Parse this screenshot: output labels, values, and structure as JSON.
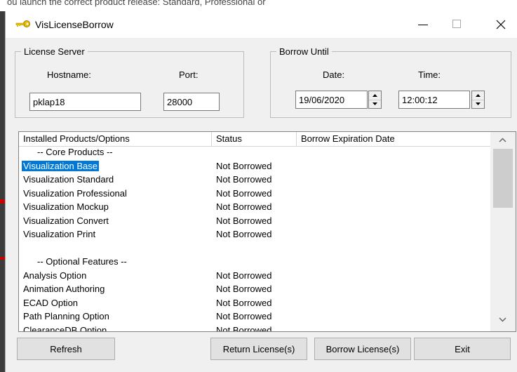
{
  "background": {
    "fragment_text": "ou launch the correct product release: Standard, Professional or"
  },
  "window": {
    "title": "VisLicenseBorrow"
  },
  "license_server": {
    "legend": "License Server",
    "hostname_label": "Hostname:",
    "hostname_value": "pklap18",
    "port_label": "Port:",
    "port_value": "28000"
  },
  "borrow_until": {
    "legend": "Borrow Until",
    "date_label": "Date:",
    "date_value": "19/06/2020",
    "time_label": "Time:",
    "time_value": "12:00:12"
  },
  "list": {
    "columns": [
      "Installed Products/Options",
      "Status",
      "Borrow Expiration Date"
    ],
    "rows": [
      {
        "name": "-- Core Products --",
        "status": "",
        "expiration": "",
        "kind": "header"
      },
      {
        "name": "Visualization Base",
        "status": "Not Borrowed",
        "expiration": "",
        "kind": "selected"
      },
      {
        "name": "Visualization Standard",
        "status": "Not Borrowed",
        "expiration": "",
        "kind": "item"
      },
      {
        "name": "Visualization Professional",
        "status": "Not Borrowed",
        "expiration": "",
        "kind": "item"
      },
      {
        "name": "Visualization Mockup",
        "status": "Not Borrowed",
        "expiration": "",
        "kind": "item"
      },
      {
        "name": "Visualization Convert",
        "status": "Not Borrowed",
        "expiration": "",
        "kind": "item"
      },
      {
        "name": "Visualization Print",
        "status": "Not Borrowed",
        "expiration": "",
        "kind": "item"
      },
      {
        "name": "",
        "status": "",
        "expiration": "",
        "kind": "blank"
      },
      {
        "name": "-- Optional Features --",
        "status": "",
        "expiration": "",
        "kind": "header"
      },
      {
        "name": "Analysis Option",
        "status": "Not Borrowed",
        "expiration": "",
        "kind": "item"
      },
      {
        "name": "Animation Authoring",
        "status": "Not Borrowed",
        "expiration": "",
        "kind": "item"
      },
      {
        "name": "ECAD Option",
        "status": "Not Borrowed",
        "expiration": "",
        "kind": "item"
      },
      {
        "name": "Path Planning Option",
        "status": "Not Borrowed",
        "expiration": "",
        "kind": "item"
      },
      {
        "name": "ClearanceDB Option",
        "status": "Not Borrowed",
        "expiration": "",
        "kind": "item"
      }
    ]
  },
  "buttons": {
    "refresh": "Refresh",
    "return": "Return License(s)",
    "borrow": "Borrow License(s)",
    "exit": "Exit"
  },
  "colors": {
    "selection": "#0078d7",
    "window_bg": "#f0f0f0",
    "key_icon": "#e8c000"
  },
  "icons": [
    "key-icon",
    "minimize-icon",
    "maximize-icon",
    "close-icon",
    "spin-up-icon",
    "spin-down-icon",
    "scroll-up-icon",
    "scroll-down-icon"
  ]
}
